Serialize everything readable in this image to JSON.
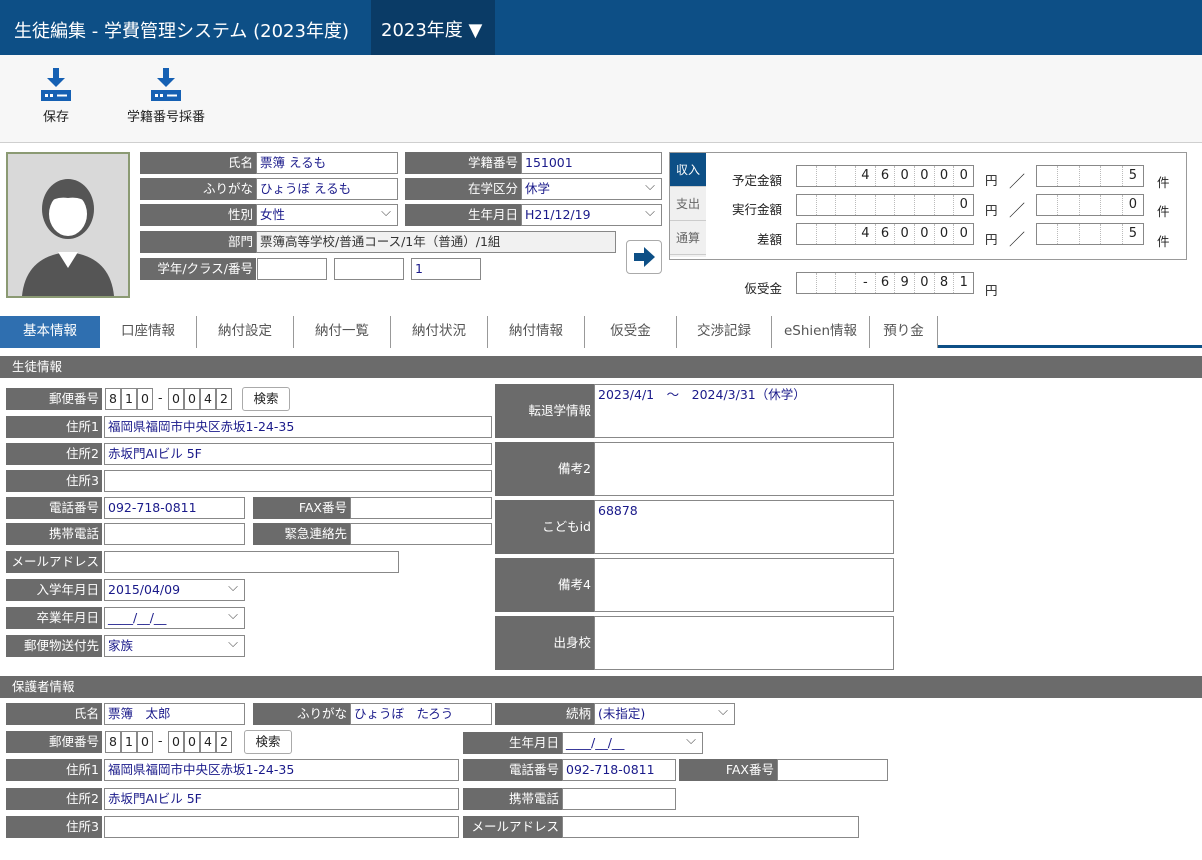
{
  "header": {
    "title": "生徒編集 - 学費管理システム (2023年度)",
    "year": "2023年度 ▼"
  },
  "toolbar": {
    "save": "保存",
    "assign": "学籍番号採番"
  },
  "student": {
    "name_label": "氏名",
    "name": "票簿 えるも",
    "kana_label": "ふりがな",
    "kana": "ひょうぼ えるも",
    "gender_label": "性別",
    "gender": "女性",
    "dept_label": "部門",
    "dept": "票簿高等学校/普通コース/1年（普通）/1組",
    "class_label": "学年/クラス/番号",
    "class1": "",
    "class2": "",
    "number": "1",
    "id_label": "学籍番号",
    "id": "151001",
    "status_label": "在学区分",
    "status": "休学",
    "birth_label": "生年月日",
    "birth": "H21/12/19"
  },
  "finance": {
    "tabs": [
      "収入",
      "支出",
      "通算"
    ],
    "planned_label": "予定金額",
    "planned_digits": [
      "",
      "",
      "",
      "4",
      "6",
      "0",
      "0",
      "0",
      "0"
    ],
    "planned_count": [
      "",
      "",
      "",
      "",
      "5"
    ],
    "actual_label": "実行金額",
    "actual_digits": [
      "",
      "",
      "",
      "",
      "",
      "",
      "",
      "",
      "0"
    ],
    "actual_count": [
      "",
      "",
      "",
      "",
      "0"
    ],
    "diff_label": "差額",
    "diff_digits": [
      "",
      "",
      "",
      "4",
      "6",
      "0",
      "0",
      "0",
      "0"
    ],
    "diff_count": [
      "",
      "",
      "",
      "",
      "5"
    ],
    "yen": "円",
    "slash": "／",
    "ken": "件",
    "kari_label": "仮受金",
    "kari_digits": [
      "",
      "",
      "",
      "-",
      "6",
      "9",
      "0",
      "8",
      "1"
    ]
  },
  "tabs": [
    "基本情報",
    "口座情報",
    "納付設定",
    "納付一覧",
    "納付状況",
    "納付情報",
    "仮受金",
    "交渉記録",
    "eShien情報",
    "預り金"
  ],
  "info": {
    "section": "生徒情報",
    "zip_label": "郵便番号",
    "zip1": [
      "8",
      "1",
      "0"
    ],
    "zip_dash": "-",
    "zip2": [
      "0",
      "0",
      "4",
      "2"
    ],
    "search": "検索",
    "addr1_label": "住所1",
    "addr1": "福岡県福岡市中央区赤坂1-24-35",
    "addr2_label": "住所2",
    "addr2": "赤坂門AIビル 5F",
    "addr3_label": "住所3",
    "addr3": "",
    "tel_label": "電話番号",
    "tel": "092-718-0811",
    "fax_label": "FAX番号",
    "fax": "",
    "mobile_label": "携帯電話",
    "mobile": "",
    "emerg_label": "緊急連絡先",
    "emerg": "",
    "mail_label": "メールアドレス",
    "mail": "",
    "enter_label": "入学年月日",
    "enter": "2015/04/09",
    "grad_label": "卒業年月日",
    "grad": "____/__/__",
    "post_label": "郵便物送付先",
    "post": "家族",
    "transfer_label": "転退学情報",
    "transfer": "2023/4/1　～　2024/3/31（休学）",
    "note2_label": "備考2",
    "note2": "",
    "child_label": "こどもid",
    "child": "68878",
    "note4_label": "備考4",
    "note4": "",
    "school_label": "出身校",
    "school": ""
  },
  "guardian": {
    "section": "保護者情報",
    "name_label": "氏名",
    "name": "票簿　太郎",
    "kana_label": "ふりがな",
    "kana": "ひょうぼ　たろう",
    "rel_label": "続柄",
    "rel": "(未指定)",
    "zip_label": "郵便番号",
    "zip1": [
      "8",
      "1",
      "0"
    ],
    "zip_dash": "-",
    "zip2": [
      "0",
      "0",
      "4",
      "2"
    ],
    "search": "検索",
    "birth_label": "生年月日",
    "birth": "____/__/__",
    "addr1_label": "住所1",
    "addr1": "福岡県福岡市中央区赤坂1-24-35",
    "tel_label": "電話番号",
    "tel": "092-718-0811",
    "fax_label": "FAX番号",
    "fax": "",
    "addr2_label": "住所2",
    "addr2": "赤坂門AIビル 5F",
    "mobile_label": "携帯電話",
    "mobile": "",
    "addr3_label": "住所3",
    "addr3": "",
    "mail_label": "メールアドレス",
    "mail": ""
  }
}
